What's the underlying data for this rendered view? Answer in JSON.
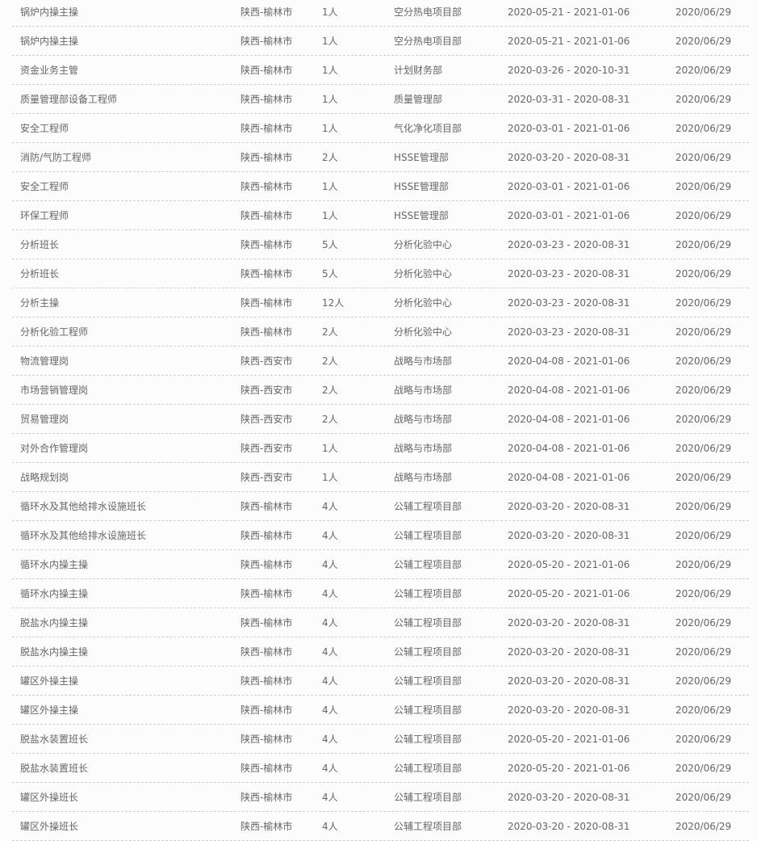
{
  "jobs": [
    [
      "锅炉内操主操",
      "陕西-榆林市",
      "1人",
      "空分热电项目部",
      "2020-05-21 - 2021-01-06",
      "2020/06/29"
    ],
    [
      "锅炉内操主操",
      "陕西-榆林市",
      "1人",
      "空分热电项目部",
      "2020-05-21 - 2021-01-06",
      "2020/06/29"
    ],
    [
      "资金业务主管",
      "陕西-榆林市",
      "1人",
      "计划财务部",
      "2020-03-26 - 2020-10-31",
      "2020/06/29"
    ],
    [
      "质量管理部设备工程师",
      "陕西-榆林市",
      "1人",
      "质量管理部",
      "2020-03-31 - 2020-08-31",
      "2020/06/29"
    ],
    [
      "安全工程师",
      "陕西-榆林市",
      "1人",
      "气化净化项目部",
      "2020-03-01 - 2021-01-06",
      "2020/06/29"
    ],
    [
      "消防/气防工程师",
      "陕西-榆林市",
      "2人",
      "HSSE管理部",
      "2020-03-20 - 2020-08-31",
      "2020/06/29"
    ],
    [
      "安全工程师",
      "陕西-榆林市",
      "1人",
      "HSSE管理部",
      "2020-03-01 - 2021-01-06",
      "2020/06/29"
    ],
    [
      "环保工程师",
      "陕西-榆林市",
      "1人",
      "HSSE管理部",
      "2020-03-01 - 2021-01-06",
      "2020/06/29"
    ],
    [
      "分析班长",
      "陕西-榆林市",
      "5人",
      "分析化验中心",
      "2020-03-23 - 2020-08-31",
      "2020/06/29"
    ],
    [
      "分析班长",
      "陕西-榆林市",
      "5人",
      "分析化验中心",
      "2020-03-23 - 2020-08-31",
      "2020/06/29"
    ],
    [
      "分析主操",
      "陕西-榆林市",
      "12人",
      "分析化验中心",
      "2020-03-23 - 2020-08-31",
      "2020/06/29"
    ],
    [
      "分析化验工程师",
      "陕西-榆林市",
      "2人",
      "分析化验中心",
      "2020-03-23 - 2020-08-31",
      "2020/06/29"
    ],
    [
      "物流管理岗",
      "陕西-西安市",
      "2人",
      "战略与市场部",
      "2020-04-08 - 2021-01-06",
      "2020/06/29"
    ],
    [
      "市场营销管理岗",
      "陕西-西安市",
      "2人",
      "战略与市场部",
      "2020-04-08 - 2021-01-06",
      "2020/06/29"
    ],
    [
      "贸易管理岗",
      "陕西-西安市",
      "2人",
      "战略与市场部",
      "2020-04-08 - 2021-01-06",
      "2020/06/29"
    ],
    [
      "对外合作管理岗",
      "陕西-西安市",
      "1人",
      "战略与市场部",
      "2020-04-08 - 2021-01-06",
      "2020/06/29"
    ],
    [
      "战略规划岗",
      "陕西-西安市",
      "1人",
      "战略与市场部",
      "2020-04-08 - 2021-01-06",
      "2020/06/29"
    ],
    [
      "循环水及其他给排水设施班长",
      "陕西-榆林市",
      "4人",
      "公辅工程项目部",
      "2020-03-20 - 2020-08-31",
      "2020/06/29"
    ],
    [
      "循环水及其他给排水设施班长",
      "陕西-榆林市",
      "4人",
      "公辅工程项目部",
      "2020-03-20 - 2020-08-31",
      "2020/06/29"
    ],
    [
      "循环水内操主操",
      "陕西-榆林市",
      "4人",
      "公辅工程项目部",
      "2020-05-20 - 2021-01-06",
      "2020/06/29"
    ],
    [
      "循环水内操主操",
      "陕西-榆林市",
      "4人",
      "公辅工程项目部",
      "2020-05-20 - 2021-01-06",
      "2020/06/29"
    ],
    [
      "脱盐水内操主操",
      "陕西-榆林市",
      "4人",
      "公辅工程项目部",
      "2020-03-20 - 2020-08-31",
      "2020/06/29"
    ],
    [
      "脱盐水内操主操",
      "陕西-榆林市",
      "4人",
      "公辅工程项目部",
      "2020-03-20 - 2020-08-31",
      "2020/06/29"
    ],
    [
      "罐区外操主操",
      "陕西-榆林市",
      "4人",
      "公辅工程项目部",
      "2020-03-20 - 2020-08-31",
      "2020/06/29"
    ],
    [
      "罐区外操主操",
      "陕西-榆林市",
      "4人",
      "公辅工程项目部",
      "2020-03-20 - 2020-08-31",
      "2020/06/29"
    ],
    [
      "脱盐水装置班长",
      "陕西-榆林市",
      "4人",
      "公辅工程项目部",
      "2020-05-20 - 2021-01-06",
      "2020/06/29"
    ],
    [
      "脱盐水装置班长",
      "陕西-榆林市",
      "4人",
      "公辅工程项目部",
      "2020-05-20 - 2021-01-06",
      "2020/06/29"
    ],
    [
      "罐区外操班长",
      "陕西-榆林市",
      "4人",
      "公辅工程项目部",
      "2020-03-20 - 2020-08-31",
      "2020/06/29"
    ],
    [
      "罐区外操班长",
      "陕西-榆林市",
      "4人",
      "公辅工程项目部",
      "2020-03-20 - 2020-08-31",
      "2020/06/29"
    ]
  ]
}
